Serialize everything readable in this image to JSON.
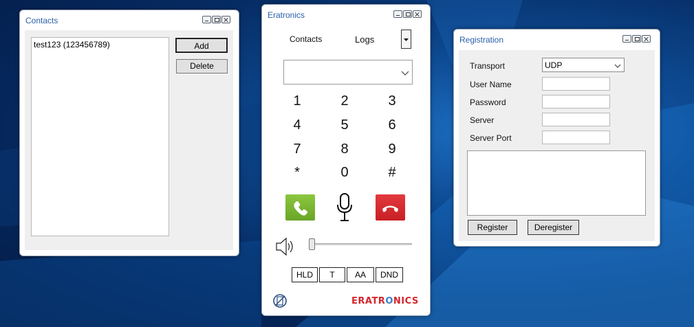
{
  "contacts_window": {
    "title": "Contacts",
    "list_items": [
      "test123 (123456789)"
    ],
    "add_label": "Add",
    "delete_label": "Delete"
  },
  "phone_window": {
    "title": "Eratronics",
    "tab_contacts": "Contacts",
    "tab_logs": "Logs",
    "number_input_value": "",
    "keys": [
      "1",
      "2",
      "3",
      "4",
      "5",
      "6",
      "7",
      "8",
      "9",
      "*",
      "0",
      "#"
    ],
    "volume_level": 0,
    "buttons": [
      "HLD",
      "T",
      "AA",
      "DND"
    ],
    "logo_text": "ERATRONICS",
    "colors": {
      "call": "#7bb534",
      "hangup": "#d92b2f",
      "logo": "#d4262c",
      "logo_o": "#3a7ec7"
    },
    "icons": [
      "phone-call-icon",
      "microphone-icon",
      "phone-hangup-icon",
      "speaker-icon",
      "status-icon"
    ]
  },
  "registration_window": {
    "title": "Registration",
    "transport_label": "Transport",
    "transport_value": "UDP",
    "username_label": "User Name",
    "password_label": "Password",
    "server_label": "Server",
    "server_port_label": "Server Port",
    "username_value": "",
    "password_value": "",
    "server_value": "",
    "server_port_value": "",
    "log_text": "",
    "register_label": "Register",
    "deregister_label": "Deregister"
  }
}
